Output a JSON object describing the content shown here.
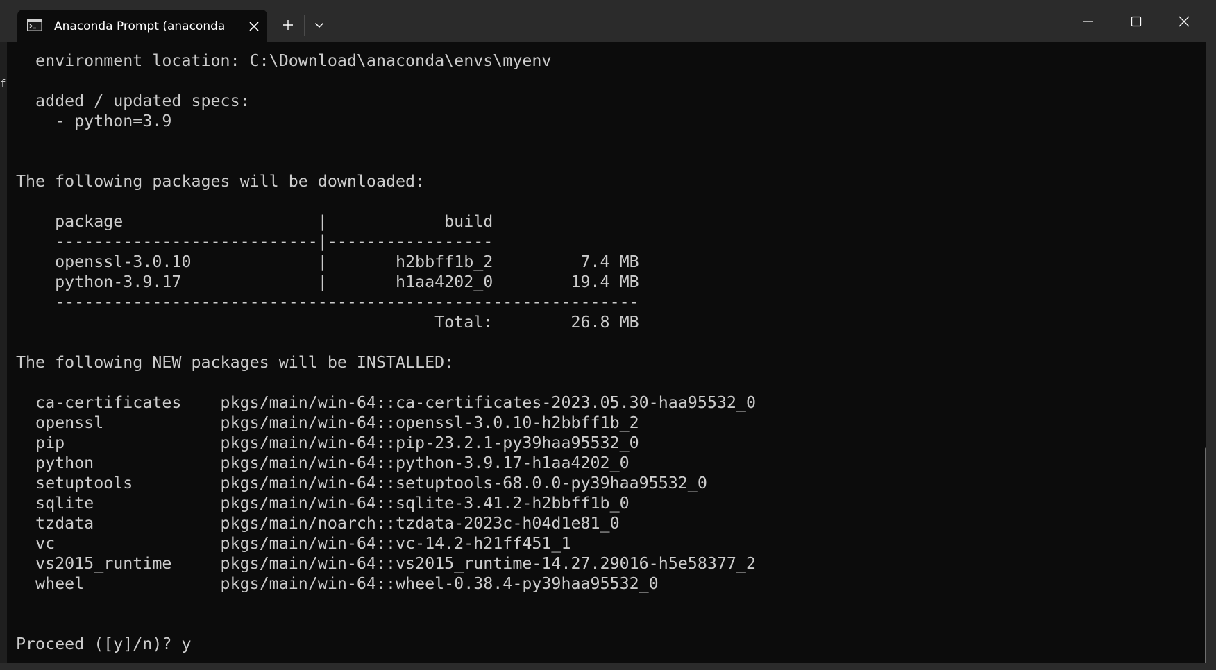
{
  "window": {
    "tab_title": "Anaconda Prompt (anaconda",
    "tab_icon": "terminal-icon",
    "new_tab_glyph": "+",
    "colors": {
      "titlebar": "#2b2b2b",
      "terminal_bg": "#0c0c0c",
      "text": "#cccccc"
    }
  },
  "terminal": {
    "side_char": "f",
    "lines": [
      "  environment location: C:\\Download\\anaconda\\envs\\myenv",
      "",
      "  added / updated specs:",
      "    - python=3.9",
      "",
      "",
      "The following packages will be downloaded:",
      "",
      "    package                    |            build",
      "    ---------------------------|-----------------",
      "    openssl-3.0.10             |       h2bbff1b_2         7.4 MB",
      "    python-3.9.17              |       h1aa4202_0        19.4 MB",
      "    ------------------------------------------------------------",
      "                                           Total:        26.8 MB",
      "",
      "The following NEW packages will be INSTALLED:",
      "",
      "  ca-certificates    pkgs/main/win-64::ca-certificates-2023.05.30-haa95532_0",
      "  openssl            pkgs/main/win-64::openssl-3.0.10-h2bbff1b_2",
      "  pip                pkgs/main/win-64::pip-23.2.1-py39haa95532_0",
      "  python             pkgs/main/win-64::python-3.9.17-h1aa4202_0",
      "  setuptools         pkgs/main/win-64::setuptools-68.0.0-py39haa95532_0",
      "  sqlite             pkgs/main/win-64::sqlite-3.41.2-h2bbff1b_0",
      "  tzdata             pkgs/main/noarch::tzdata-2023c-h04d1e81_0",
      "  vc                 pkgs/main/win-64::vc-14.2-h21ff451_1",
      "  vs2015_runtime     pkgs/main/win-64::vs2015_runtime-14.27.29016-h5e58377_2",
      "  wheel              pkgs/main/win-64::wheel-0.38.4-py39haa95532_0",
      "",
      "",
      "Proceed ([y]/n)? y"
    ]
  }
}
